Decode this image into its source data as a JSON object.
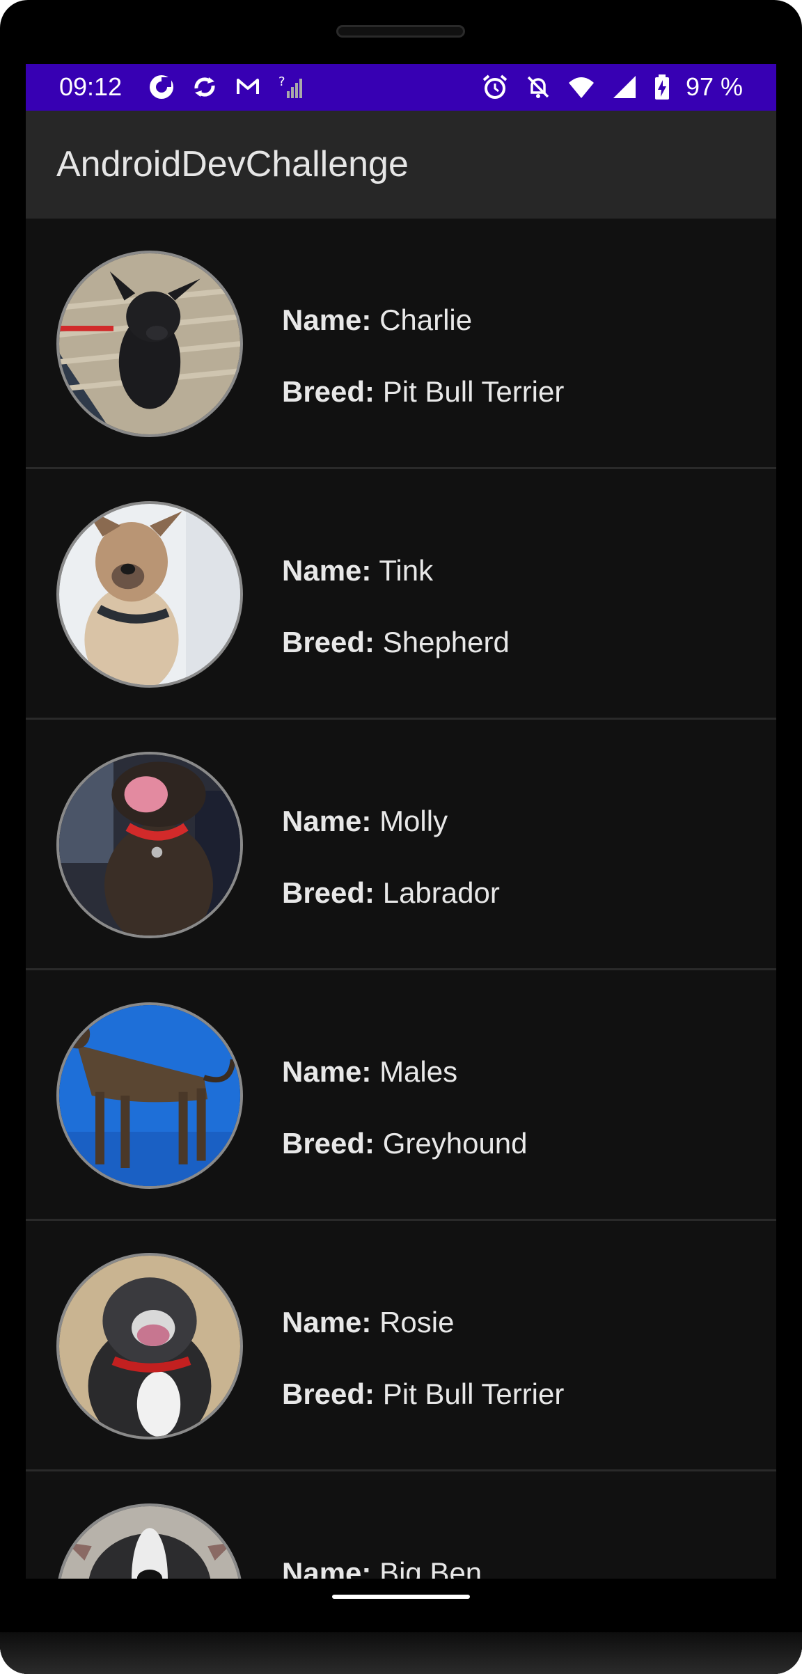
{
  "status_bar": {
    "time": "09:12",
    "battery": "97 %",
    "icons_left": [
      "pocket-casts-icon",
      "sync-icon",
      "gmail-icon",
      "no-signal-icon"
    ],
    "icons_right": [
      "alarm-icon",
      "notifications-off-icon",
      "wifi-icon",
      "cell-signal-icon",
      "battery-charging-icon"
    ],
    "background_color": "#3700b3"
  },
  "app_bar": {
    "title": "AndroidDevChallenge",
    "background_color": "#272727"
  },
  "labels": {
    "name": "Name:",
    "breed": "Breed:"
  },
  "puppies": [
    {
      "name": "Charlie",
      "breed": "Pit Bull Terrier"
    },
    {
      "name": "Tink",
      "breed": "Shepherd"
    },
    {
      "name": "Molly",
      "breed": "Labrador"
    },
    {
      "name": "Males",
      "breed": "Greyhound"
    },
    {
      "name": "Rosie",
      "breed": "Pit Bull Terrier"
    },
    {
      "name": "Big Ben",
      "breed": ""
    }
  ]
}
